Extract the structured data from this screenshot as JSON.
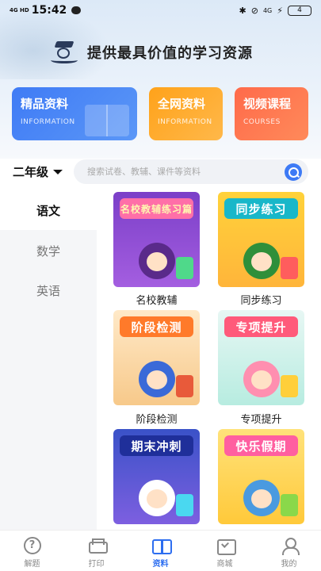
{
  "status_bar": {
    "network": "4G HD",
    "time": "15:42",
    "battery": "4",
    "icons": [
      "message-icon",
      "bluetooth-icon",
      "mute-icon",
      "4g-icon",
      "charging-icon",
      "battery-icon"
    ]
  },
  "slogan": "提供最具价值的学习资源",
  "cards": [
    {
      "title": "精品资料",
      "subtitle": "INFORMATION"
    },
    {
      "title": "全网资料",
      "subtitle": "INFORMATION"
    },
    {
      "title": "视频课程",
      "subtitle": "COURSES"
    }
  ],
  "grade": {
    "selected": "二年级"
  },
  "search": {
    "placeholder": "搜索试卷、教辅、课件等资料"
  },
  "subjects": [
    {
      "label": "语文",
      "active": true
    },
    {
      "label": "数学",
      "active": false
    },
    {
      "label": "英语",
      "active": false
    }
  ],
  "resources": [
    {
      "cover_title": "名校教辅练习篇",
      "label": "名校教辅"
    },
    {
      "cover_title": "同步练习",
      "label": "同步练习"
    },
    {
      "cover_title": "阶段检测",
      "label": "阶段检测"
    },
    {
      "cover_title": "专项提升",
      "label": "专项提升"
    },
    {
      "cover_title": "期末冲刺",
      "label": ""
    },
    {
      "cover_title": "快乐假期",
      "label": ""
    }
  ],
  "tabbar": [
    {
      "label": "解题",
      "icon": "help-icon",
      "active": false
    },
    {
      "label": "打印",
      "icon": "printer-icon",
      "active": false
    },
    {
      "label": "资料",
      "icon": "book-icon",
      "active": true
    },
    {
      "label": "商城",
      "icon": "mall-icon",
      "active": false
    },
    {
      "label": "我的",
      "icon": "profile-icon",
      "active": false
    }
  ],
  "colors": {
    "accent": "#2d6ef0",
    "card_blue": "#3f7bf5",
    "card_orange": "#ffa21a",
    "card_red": "#ff6a4a"
  }
}
